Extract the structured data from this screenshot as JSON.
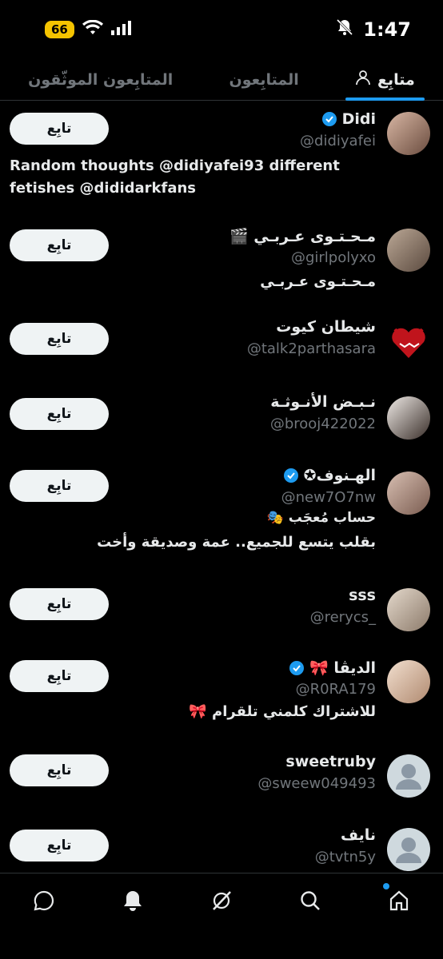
{
  "status": {
    "battery": "66",
    "time": "1:47"
  },
  "tabs": [
    {
      "label": "متابِع",
      "active": true
    },
    {
      "label": "المتابِعون",
      "active": false
    },
    {
      "label": "المتابِعون الموثّقون",
      "active": false
    }
  ],
  "follow_label": "تابِع",
  "users": [
    {
      "name": "Didi",
      "handle": "@didiyafei",
      "verified": true,
      "bio": "Random thoughts @didiyafei93 different fetishes @dididarkfans",
      "avatar_color": "#8a6a5a"
    },
    {
      "name": "مـحـتـوى عـربـي 🎬",
      "handle": "@girlpolyxo",
      "verified": false,
      "bio": "مـحـتـوى عـربـي",
      "avatar_color": "#9a8a7a"
    },
    {
      "name": "شيطان كيوت",
      "handle": "@talk2parthasara",
      "verified": false,
      "bio": "",
      "avatar_color": "#c0141c"
    },
    {
      "name": "نـبـض الأنـوثـة",
      "handle": "@brooj422022",
      "verified": false,
      "bio": "",
      "avatar_color": "#d9d4cf"
    },
    {
      "name": "الهـنوف✪",
      "handle": "@new7O7nw",
      "verified": true,
      "bio": "حساب مُعجَب 🎭",
      "bio2": "بقلب يتسع للجميع.. عمة وصديقة وأخت",
      "avatar_color": "#b89c90"
    },
    {
      "name": "sss",
      "handle": "@rerycs_",
      "verified": false,
      "bio": "",
      "avatar_color": "#cbb9a8"
    },
    {
      "name": "الديڤا 🎀",
      "handle": "@R0RA179",
      "verified": true,
      "bio": "للاشتراك كلمني تلقرام 🎀",
      "avatar_color": "#e5c9b3"
    },
    {
      "name": "sweetruby",
      "handle": "@sweew049493",
      "verified": false,
      "bio": "",
      "avatar_color": "#cfd9de"
    },
    {
      "name": "نايف",
      "handle": "@tvtn5y",
      "verified": false,
      "bio": "",
      "avatar_color": "#cfd9de"
    }
  ],
  "colors": {
    "accent": "#1d9bf0",
    "background": "#000000",
    "muted": "#71767b"
  }
}
